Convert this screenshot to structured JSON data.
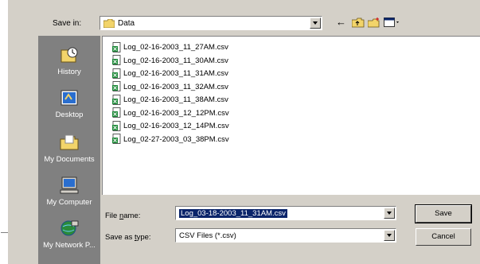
{
  "save_in": {
    "label": "Save in:",
    "value": "Data"
  },
  "toolbar": {
    "back_icon": "back-arrow-icon",
    "up_icon": "up-folder-icon",
    "new_folder_icon": "new-folder-icon",
    "view_icon": "view-menu-icon"
  },
  "places": [
    {
      "label": "History",
      "icon": "history-icon"
    },
    {
      "label": "Desktop",
      "icon": "desktop-icon"
    },
    {
      "label": "My Documents",
      "icon": "my-documents-icon"
    },
    {
      "label": "My Computer",
      "icon": "my-computer-icon"
    },
    {
      "label": "My Network P...",
      "icon": "network-icon"
    }
  ],
  "files": [
    "Log_02-16-2003_11_27AM.csv",
    "Log_02-16-2003_11_30AM.csv",
    "Log_02-16-2003_11_31AM.csv",
    "Log_02-16-2003_11_32AM.csv",
    "Log_02-16-2003_11_38AM.csv",
    "Log_02-16-2003_12_12PM.csv",
    "Log_02-16-2003_12_14PM.csv",
    "Log_02-27-2003_03_38PM.csv"
  ],
  "file_name": {
    "label": "File name:",
    "value": "Log_03-18-2003_11_31AM.csv"
  },
  "save_as_type": {
    "label": "Save as type:",
    "value": "CSV Files (*.csv)"
  },
  "buttons": {
    "save": "Save",
    "cancel": "Cancel"
  }
}
